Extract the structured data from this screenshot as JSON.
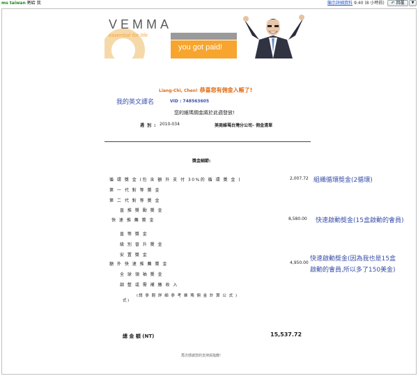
{
  "header": {
    "sender_name": "ms taiwan",
    "sender_suffix": "寄給 我",
    "meta_link": "顯示詳細資料",
    "time": "9:40 (8 小時前)",
    "reply_label": "回覆",
    "more_label": "▼"
  },
  "banner": {
    "logo": "VEMMA",
    "tagline": "essential for life",
    "slogan": "you got paid!"
  },
  "email": {
    "congrats_name": "Liang-Chi, Chen!",
    "congrats_text": " 恭喜您有佣金入帳了!",
    "annotation_name": "我的英文譯名",
    "vid": "VID : 748563605",
    "payout_line": "您的維瑪佣金將於此週發放!",
    "week_label": "週 別 :",
    "week_value": "2010-034",
    "company": "美商維瑪台灣分公司– 佣金清單",
    "details_title": "獎金細節:",
    "rows": [
      {
        "label": "循 環 獎 金 (包 含 額 外 支 付 30%的 循 環 獎 金 )",
        "amount": "2,007.72"
      },
      {
        "label": "第 一 代 對 等 獎 金",
        "amount": ""
      },
      {
        "label": "第 二 代 對 等 獎 金",
        "amount": ""
      },
      {
        "label": "直 推 獎 勵 獎 金",
        "amount": ""
      },
      {
        "label": "快 速 推 薦 獎 金",
        "amount": "8,580.00"
      },
      {
        "label": "直 等 獎 金",
        "amount": ""
      },
      {
        "label": "級 別 晉 升 獎 金",
        "amount": ""
      },
      {
        "label": "安 置 獎 金",
        "amount": ""
      },
      {
        "label": "額 外 快 速 推 薦 獎 金",
        "amount": "4,950.00"
      },
      {
        "label": "全 球 領 袖 獎 金",
        "amount": ""
      },
      {
        "label": "調 整 或 需 補 繳 收 入",
        "amount": ""
      },
      {
        "label": "(請 參 閱 詳 細 參 考 維 瑪 佣 金 計 算 公 式 )",
        "amount": ""
      }
    ],
    "annotations": {
      "a1": "組織循環獎金(2循環)",
      "a2": "快速啟動獎金(15盒啟動的會員)",
      "a3_line1": "快速啟動獎金(因為我也是15盒",
      "a3_line2": "啟動的會員,所以多了150美金)"
    },
    "total_label": "總 金 額 (NT)",
    "total_value": "15,537.72",
    "footer": "再次感謝您的支持與指教!"
  }
}
